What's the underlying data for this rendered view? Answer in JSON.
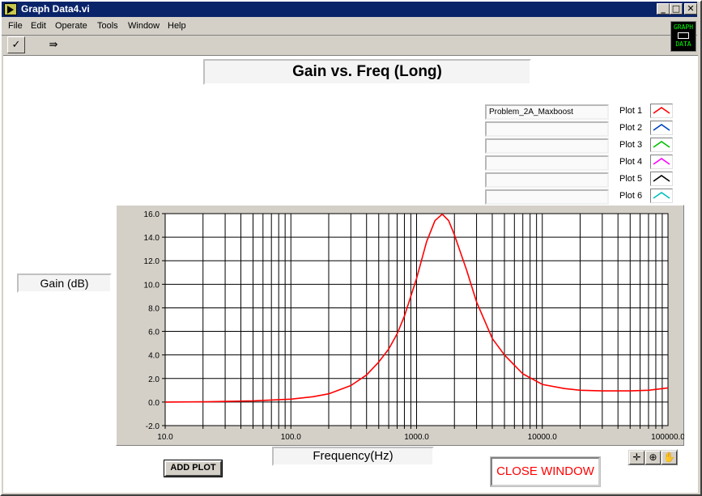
{
  "window": {
    "title": "Graph Data4.vi",
    "minimize": "_",
    "maximize": "□",
    "close": "✕"
  },
  "menu": [
    {
      "label": "File"
    },
    {
      "label": "Edit"
    },
    {
      "label": "Operate"
    },
    {
      "label": "Tools"
    },
    {
      "label": "Window"
    },
    {
      "label": "Help"
    }
  ],
  "toolbar": {
    "run_glyph": "✓",
    "step_glyph": "⇛",
    "logo_top": "GRAPH",
    "logo_bottom": "DATA"
  },
  "panel": {
    "chart_title": "Gain vs. Freq (Long)",
    "y_label": "Gain (dB)",
    "x_label": "Frequency(Hz)",
    "add_plot_label": "ADD PLOT",
    "close_label": "CLOSE WINDOW"
  },
  "legend": [
    {
      "name": "Problem_2A_Maxboost",
      "label": "Plot 1",
      "color": "#ff0000"
    },
    {
      "name": "",
      "label": "Plot 2",
      "color": "#0040c0"
    },
    {
      "name": "",
      "label": "Plot 3",
      "color": "#00c000"
    },
    {
      "name": "",
      "label": "Plot 4",
      "color": "#ff00ff"
    },
    {
      "name": "",
      "label": "Plot 5",
      "color": "#000000"
    },
    {
      "name": "",
      "label": "Plot 6",
      "color": "#00c0c0"
    }
  ],
  "palette": {
    "cursor_glyph": "✛",
    "zoom_glyph": "⊕",
    "pan_glyph": "✋"
  },
  "chart_data": {
    "type": "line",
    "title": "Gain vs. Freq (Long)",
    "xlabel": "Frequency(Hz)",
    "ylabel": "Gain (dB)",
    "x_scale": "log",
    "xlim": [
      10,
      100000
    ],
    "ylim": [
      -2,
      16
    ],
    "x_ticks": [
      "10.0",
      "100.0",
      "1000.0",
      "10000.0",
      "100000.0"
    ],
    "y_ticks": [
      "-2.0",
      "0.0",
      "2.0",
      "4.0",
      "6.0",
      "8.0",
      "10.0",
      "12.0",
      "14.0",
      "16.0"
    ],
    "grid": true,
    "series": [
      {
        "name": "Problem_2A_Maxboost",
        "color": "#ff0000",
        "x": [
          10,
          20,
          50,
          100,
          150,
          200,
          300,
          400,
          500,
          600,
          700,
          800,
          1000,
          1200,
          1400,
          1600,
          1800,
          2000,
          2500,
          3000,
          4000,
          5000,
          7000,
          10000,
          15000,
          20000,
          30000,
          50000,
          70000,
          100000
        ],
        "y": [
          0.0,
          0.02,
          0.1,
          0.25,
          0.45,
          0.7,
          1.4,
          2.3,
          3.4,
          4.5,
          5.8,
          7.3,
          10.5,
          13.6,
          15.4,
          15.95,
          15.4,
          14.2,
          11.2,
          8.5,
          5.4,
          4.0,
          2.4,
          1.5,
          1.15,
          1.0,
          0.95,
          0.95,
          1.0,
          1.2
        ]
      }
    ]
  }
}
